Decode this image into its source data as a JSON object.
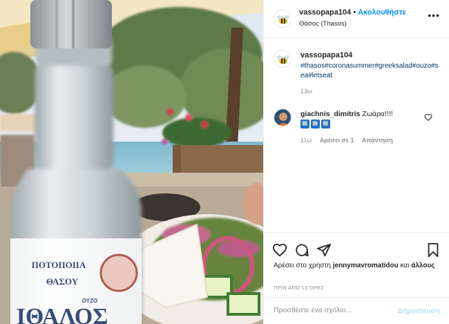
{
  "post": {
    "username": "vassopapa104",
    "separator": "•",
    "follow_label": "Ακολουθήστε",
    "location": "Θάσος (Thasos)",
    "more_icon": "more-horizontal-icon",
    "caption": {
      "username": "vassopapa104",
      "hashtags": "#thasos#coronasummer#greeksalad#ouzo#sea#letseat",
      "time": "13ω"
    },
    "comments": [
      {
        "username": "giachnis_dimitris",
        "text": "Ζωάρα!!!!",
        "emoji": [
          "🆗",
          "🆗",
          "🆗"
        ],
        "time": "11ω",
        "likes": "Αρέσει σε 1",
        "reply_label": "Απάντηση"
      }
    ],
    "liked_by": {
      "prefix": "Αρέσει στο χρήστη",
      "user": "jennymavromatidou",
      "conj": "και",
      "others": "άλλους"
    },
    "posted_ago": "ΠΡΙΝ ΑΠΌ 13 ΏΡΕΣ",
    "add_comment_placeholder": "Προσθέστε ένα σχόλιο...",
    "post_button": "Δημοσίευση",
    "bottle_label": {
      "line1": "ΠΟΤΟΠΟΙΙΑ",
      "line2": "ΘΑΣΟΥ",
      "line3": "ΟΥΖΟ",
      "line4": "ΙΘΑΛΟΣ"
    }
  },
  "colors": {
    "link": "#00376b",
    "follow": "#0095f6",
    "muted": "#8e8e8e"
  }
}
